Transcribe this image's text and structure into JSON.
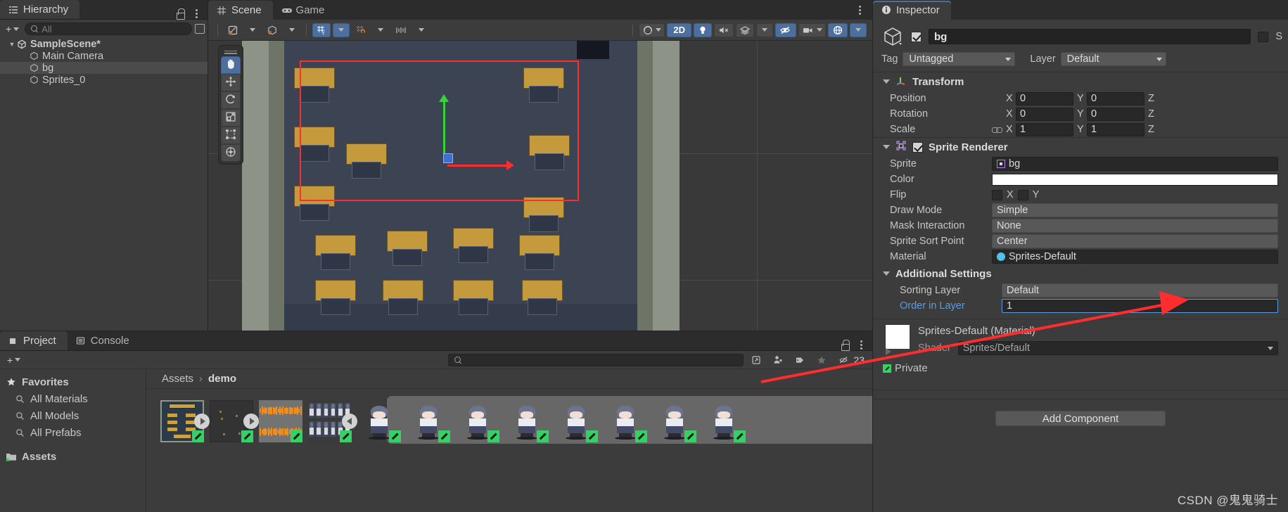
{
  "hierarchy": {
    "tab_label": "Hierarchy",
    "tab_icon": "hierarchy-icon",
    "search_placeholder": "All",
    "create_label": "+",
    "items": [
      {
        "label": "SampleScene*",
        "icon": "unity-scene-icon",
        "depth": 0,
        "selected": false,
        "bold": true
      },
      {
        "label": "Main Camera",
        "icon": "gameobject-cube-icon",
        "depth": 1,
        "selected": false,
        "bold": false
      },
      {
        "label": "bg",
        "icon": "gameobject-cube-icon",
        "depth": 1,
        "selected": true,
        "bold": false
      },
      {
        "label": "Sprites_0",
        "icon": "gameobject-cube-icon",
        "depth": 1,
        "selected": false,
        "bold": false
      }
    ]
  },
  "scene": {
    "tabs": [
      {
        "label": "Scene",
        "icon": "scene-grid-icon",
        "active": true
      },
      {
        "label": "Game",
        "icon": "game-controller-icon",
        "active": false
      }
    ],
    "toolbar_left": [
      {
        "name": "draw-mode-shaded",
        "icon": "shading-mode-icon",
        "has_caret": true,
        "on": false
      },
      {
        "name": "2d-3d-toggle",
        "icon": "cube-wire-icon",
        "has_caret": true,
        "on": false
      },
      {
        "name": "grid-visibility",
        "icon": "grid-y-icon",
        "has_caret": true,
        "on": true
      },
      {
        "name": "grid-snapping",
        "icon": "grid-snap-icon",
        "has_caret": true,
        "on": false
      },
      {
        "name": "grid-increment-snap",
        "icon": "snap-increment-icon",
        "has_caret": true,
        "on": false
      }
    ],
    "toolbar_right": [
      {
        "name": "gizmo-sphere",
        "icon": "sphere-icon",
        "has_caret": true,
        "on": false,
        "label": ""
      },
      {
        "name": "toggle-2d",
        "icon": "",
        "has_caret": false,
        "on": true,
        "label": "2D"
      },
      {
        "name": "scene-lighting",
        "icon": "lightbulb-icon",
        "has_caret": false,
        "on": true,
        "label": ""
      },
      {
        "name": "scene-audio",
        "icon": "audio-mute-icon",
        "has_caret": false,
        "on": false,
        "label": ""
      },
      {
        "name": "scene-fx",
        "icon": "fx-layers-icon",
        "has_caret": true,
        "on": false,
        "label": ""
      },
      {
        "name": "scene-visibility",
        "icon": "eye-off-icon",
        "has_caret": false,
        "on": true,
        "label": ""
      },
      {
        "name": "scene-camera",
        "icon": "camera-icon",
        "has_caret": true,
        "on": false,
        "label": ""
      },
      {
        "name": "gizmos-toggle",
        "icon": "gizmos-globe-icon",
        "has_caret": true,
        "on": true,
        "label": ""
      }
    ],
    "tools_overlay": [
      {
        "name": "hand-tool",
        "icon": "hand-icon",
        "active": true
      },
      {
        "name": "move-tool",
        "icon": "move-arrows-icon",
        "active": false
      },
      {
        "name": "rotate-tool",
        "icon": "rotate-icon",
        "active": false
      },
      {
        "name": "scale-tool",
        "icon": "scale-icon",
        "active": false
      },
      {
        "name": "rect-tool",
        "icon": "rect-transform-icon",
        "active": false
      },
      {
        "name": "transform-tool",
        "icon": "transform-icon",
        "active": false
      }
    ]
  },
  "project": {
    "tabs": [
      {
        "label": "Project",
        "icon": "project-icon",
        "active": true
      },
      {
        "label": "Console",
        "icon": "console-icon",
        "active": false
      }
    ],
    "search_placeholder": "",
    "count_badge": "23",
    "tree": [
      {
        "label": "Favorites",
        "icon": "star-icon",
        "kind": "head"
      },
      {
        "label": "All Materials",
        "icon": "search-icon",
        "kind": "sub"
      },
      {
        "label": "All Models",
        "icon": "search-icon",
        "kind": "sub"
      },
      {
        "label": "All Prefabs",
        "icon": "search-icon",
        "kind": "sub"
      },
      {
        "label": "Assets",
        "icon": "folder-icon",
        "kind": "head"
      }
    ],
    "breadcrumb": {
      "root": "Assets",
      "separator": "›",
      "current": "demo"
    },
    "assets": [
      {
        "name": "",
        "kind": "video-board",
        "badge": "play-right",
        "script_badge": true,
        "selected": false
      },
      {
        "name": "",
        "kind": "video-dark",
        "badge": "play-right",
        "script_badge": true,
        "selected": false
      },
      {
        "name": "",
        "kind": "audio-waveform",
        "badge": "",
        "script_badge": true,
        "selected": false
      },
      {
        "name": "",
        "kind": "spritesheet",
        "badge": "play-left",
        "script_badge": true,
        "selected": false
      },
      {
        "name": "",
        "kind": "character",
        "badge": "",
        "script_badge": true,
        "selected": true
      },
      {
        "name": "",
        "kind": "character",
        "badge": "",
        "script_badge": true,
        "selected": true
      },
      {
        "name": "",
        "kind": "character",
        "badge": "",
        "script_badge": true,
        "selected": true
      },
      {
        "name": "",
        "kind": "character",
        "badge": "",
        "script_badge": true,
        "selected": true
      },
      {
        "name": "",
        "kind": "character",
        "badge": "",
        "script_badge": true,
        "selected": true
      },
      {
        "name": "",
        "kind": "character",
        "badge": "",
        "script_badge": true,
        "selected": true
      },
      {
        "name": "",
        "kind": "character",
        "badge": "",
        "script_badge": true,
        "selected": true
      },
      {
        "name": "",
        "kind": "character",
        "badge": "",
        "script_badge": true,
        "selected": true
      }
    ]
  },
  "inspector": {
    "tab_label": "Inspector",
    "tab_icon": "info-icon",
    "object": {
      "name": "bg",
      "enabled": true,
      "static_label": "S",
      "tag_label": "Tag",
      "tag_value": "Untagged",
      "layer_label": "Layer",
      "layer_value": "Default"
    },
    "transform": {
      "title": "Transform",
      "rows": [
        {
          "label": "Position",
          "x": "0",
          "y": "0",
          "z_label": "Z",
          "has_link": false
        },
        {
          "label": "Rotation",
          "x": "0",
          "y": "0",
          "z_label": "Z",
          "has_link": false
        },
        {
          "label": "Scale",
          "x": "1",
          "y": "1",
          "z_label": "Z",
          "has_link": true
        }
      ],
      "axis_x": "X",
      "axis_y": "Y"
    },
    "sprite_renderer": {
      "title": "Sprite Renderer",
      "enabled": true,
      "rows": [
        {
          "label": "Sprite",
          "value": "bg",
          "style": "object",
          "icon": "sprite-icon"
        },
        {
          "label": "Color",
          "value": "",
          "style": "color",
          "color": "#ffffff"
        },
        {
          "label": "Flip",
          "value": "",
          "style": "flip",
          "x_label": "X",
          "y_label": "Y"
        },
        {
          "label": "Draw Mode",
          "value": "Simple",
          "style": "popup"
        },
        {
          "label": "Mask Interaction",
          "value": "None",
          "style": "popup"
        },
        {
          "label": "Sprite Sort Point",
          "value": "Center",
          "style": "popup"
        },
        {
          "label": "Material",
          "value": "Sprites-Default",
          "style": "object",
          "icon": "material-icon"
        }
      ],
      "additional_settings": {
        "title": "Additional Settings",
        "rows": [
          {
            "label": "Sorting Layer",
            "value": "Default",
            "style": "popup",
            "highlight": false
          },
          {
            "label": "Order in Layer",
            "value": "1",
            "style": "field",
            "highlight": true
          }
        ]
      }
    },
    "material": {
      "title": "Sprites-Default (Material)",
      "shader_label": "Shader",
      "shader_value": "Sprites/Default"
    },
    "private_label": "Private",
    "add_component_label": "Add Component",
    "watermark": "CSDN @鬼鬼骑士"
  },
  "colors": {
    "accent_blue": "#4c6f9e",
    "panel_bg": "#3c3c3c",
    "dark_bg": "#2c2c2c",
    "field_bg": "#282828",
    "annotation_red": "#ff2d2d",
    "green_badge": "#35d164",
    "highlight_blue": "#5f9bdc"
  }
}
